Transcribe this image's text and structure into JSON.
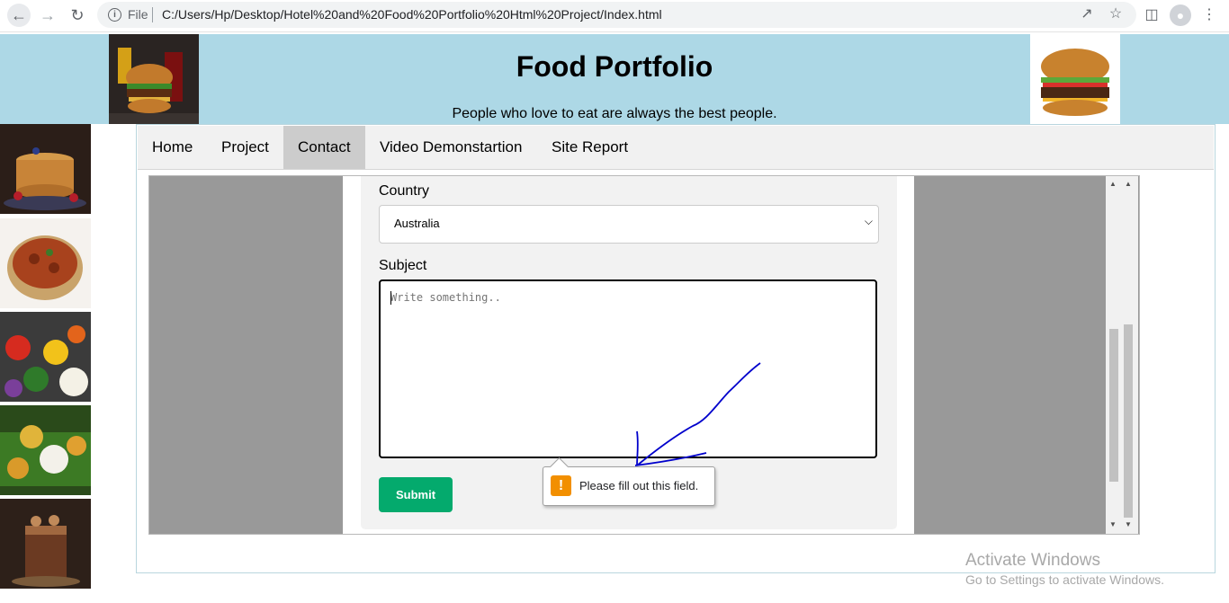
{
  "browser": {
    "scheme": "File",
    "url": "C:/Users/Hp/Desktop/Hotel%20and%20Food%20Portfolio%20Html%20Project/Index.html"
  },
  "header": {
    "title": "Food Portfolio",
    "tagline": "People who love to eat are always the best people."
  },
  "nav": {
    "items": [
      {
        "label": "Home"
      },
      {
        "label": "Project"
      },
      {
        "label": "Contact"
      },
      {
        "label": "Video Demonstartion"
      },
      {
        "label": "Site Report"
      }
    ],
    "active": "Contact"
  },
  "form": {
    "country_label": "Country",
    "country_value": "Australia",
    "subject_label": "Subject",
    "subject_placeholder": "Write something..",
    "submit_label": "Submit"
  },
  "tooltip": {
    "text": "Please fill out this field."
  },
  "watermark": {
    "title": "Activate Windows",
    "subtitle": "Go to Settings to activate Windows."
  },
  "side_images": [
    "pancakes",
    "curry",
    "vegetables",
    "idli",
    "chocolate-cake"
  ],
  "colors": {
    "header_bg": "#add8e6",
    "submit_bg": "#04aa6d",
    "nav_active_bg": "#cccccc",
    "frame_bg": "#999999",
    "warning": "#f28f00",
    "annotation": "#0000cc"
  }
}
